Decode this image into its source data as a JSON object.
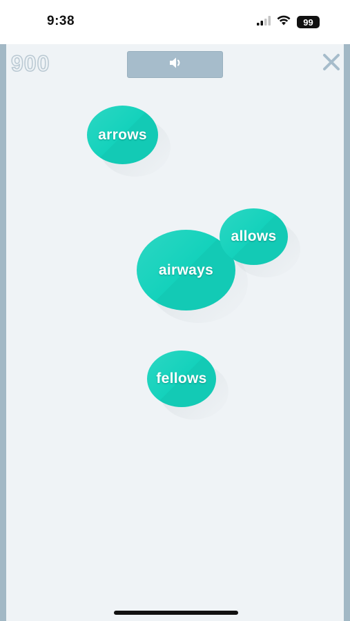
{
  "status_bar": {
    "time": "9:38",
    "battery": "99",
    "icons": [
      "cellular-signal-icon",
      "wifi-icon",
      "battery-icon"
    ]
  },
  "header": {
    "score": "900",
    "sound_icon": "speaker-icon",
    "close_icon": "close-icon"
  },
  "bubbles": [
    {
      "word": "arrows"
    },
    {
      "word": "allows"
    },
    {
      "word": "airways"
    },
    {
      "word": "fellows"
    }
  ],
  "colors": {
    "bubble": "#14d2bc",
    "board": "#eff3f6",
    "frame": "#a2b8c5",
    "button": "#a6bccb"
  }
}
